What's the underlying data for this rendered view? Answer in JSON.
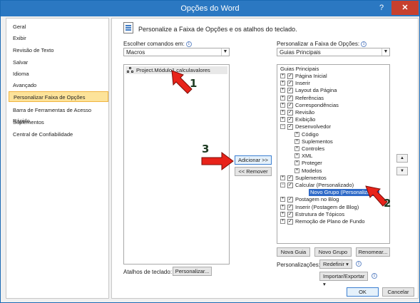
{
  "titlebar": {
    "title": "Opções do Word",
    "help": "?",
    "close": "✕"
  },
  "sidebar": {
    "items": [
      {
        "label": "Geral"
      },
      {
        "label": "Exibir"
      },
      {
        "label": "Revisão de Texto"
      },
      {
        "label": "Salvar"
      },
      {
        "label": "Idioma"
      },
      {
        "label": "Avançado"
      },
      {
        "label": "Personalizar Faixa de Opções",
        "selected": true
      },
      {
        "label": "Barra de Ferramentas de Acesso Rápido"
      },
      {
        "label": "Suplementos"
      },
      {
        "label": "Central de Confiabilidade"
      }
    ]
  },
  "main": {
    "header": "Personalize a Faixa de Opções e os atalhos do teclado.",
    "left": {
      "choose_label": "Escolher comandos em:",
      "choose_value": "Macros",
      "commands": [
        "Project.Módulo1.calculavalores"
      ]
    },
    "right": {
      "customize_label": "Personalizar a Faixa de Opções:",
      "customize_value": "Guias Principais",
      "tree_header": "Guias Principais",
      "tree": [
        {
          "label": "Página Inicial",
          "level": 0,
          "expander": "+",
          "checked": true
        },
        {
          "label": "Inserir",
          "level": 0,
          "expander": "+",
          "checked": true
        },
        {
          "label": "Layout da Página",
          "level": 0,
          "expander": "+",
          "checked": true
        },
        {
          "label": "Referências",
          "level": 0,
          "expander": "+",
          "checked": true
        },
        {
          "label": "Correspondências",
          "level": 0,
          "expander": "+",
          "checked": true
        },
        {
          "label": "Revisão",
          "level": 0,
          "expander": "+",
          "checked": true
        },
        {
          "label": "Exibição",
          "level": 0,
          "expander": "+",
          "checked": true
        },
        {
          "label": "Desenvolvedor",
          "level": 0,
          "expander": "−",
          "checked": true
        },
        {
          "label": "Código",
          "level": 1,
          "expander": "+"
        },
        {
          "label": "Suplementos",
          "level": 1,
          "expander": "+"
        },
        {
          "label": "Controles",
          "level": 1,
          "expander": "+"
        },
        {
          "label": "XML",
          "level": 1,
          "expander": "+"
        },
        {
          "label": "Proteger",
          "level": 1,
          "expander": "+"
        },
        {
          "label": "Modelos",
          "level": 1,
          "expander": "+"
        },
        {
          "label": "Suplementos",
          "level": 0,
          "expander": "+",
          "checked": true
        },
        {
          "label": "Calcular (Personalizado)",
          "level": 0,
          "expander": "−",
          "checked": true
        },
        {
          "label": "Novo Grupo (Personalizado)",
          "level": 1,
          "selected": true
        },
        {
          "label": "Postagem no Blog",
          "level": 0,
          "expander": "+",
          "checked": true
        },
        {
          "label": "Inserir (Postagem de Blog)",
          "level": 0,
          "expander": "+",
          "checked": true
        },
        {
          "label": "Estrutura de Tópicos",
          "level": 0,
          "expander": "+",
          "checked": true
        },
        {
          "label": "Remoção de Plano de Fundo",
          "level": 0,
          "expander": "+",
          "checked": true
        }
      ],
      "nova_guia": "Nova Guia",
      "novo_grupo": "Novo Grupo",
      "renomear": "Renomear...",
      "personalizacoes_label": "Personalizações:",
      "redefinir": "Redefinir",
      "importar": "Importar/Exportar"
    },
    "add_button": "Adicionar >>",
    "remove_button": "<< Remover",
    "shortcuts_label": "Atalhos de teclado:",
    "personalizar_button": "Personalizar...",
    "ok": "OK",
    "cancel": "Cancelar"
  },
  "annotations": {
    "one": "1",
    "two": "2",
    "three": "3",
    "color": "#e8231a"
  }
}
